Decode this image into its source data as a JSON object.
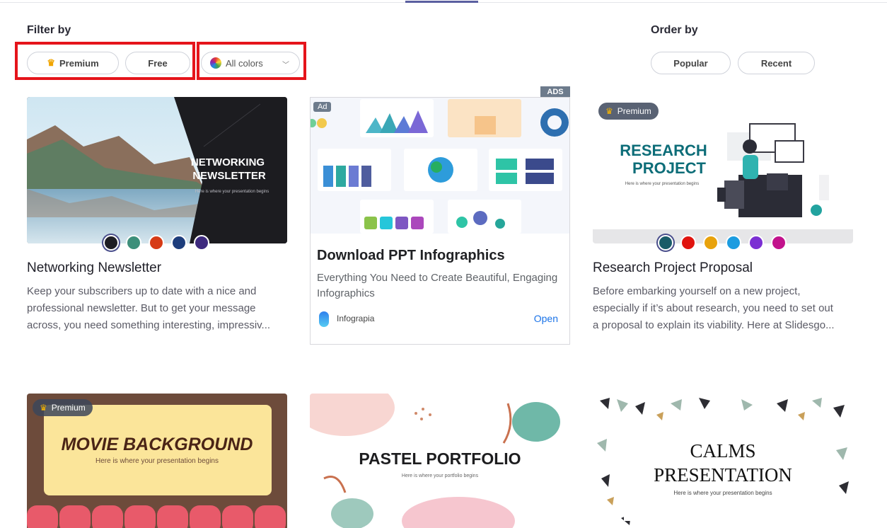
{
  "filter": {
    "label": "Filter by",
    "premium": "Premium",
    "free": "Free",
    "colors_placeholder": "All colors"
  },
  "order": {
    "label": "Order by",
    "popular": "Popular",
    "recent": "Recent"
  },
  "cards": [
    {
      "title": "Networking Newsletter",
      "image_title_line1": "NETWORKING",
      "image_title_line2": "NEWSLETTER",
      "image_subtitle": "Here is where your presentation begins",
      "desc_line1": "Keep your subscribers up to date with a nice and",
      "desc_line2": "professional newsletter. But to get your message",
      "desc_line3": "across, you need something interesting, impressiv...",
      "swatches": [
        "#1e1e24",
        "#3d8f7a",
        "#d63b16",
        "#1d3d7c",
        "#3e2a7e"
      ]
    },
    {
      "title": "Research Project Proposal",
      "badge": "Premium",
      "image_title_line1": "RESEARCH",
      "image_title_line2": "PROJECT",
      "image_subtitle": "Here is where your presentation begins",
      "desc_line1": "Before embarking yourself on a new project,",
      "desc_line2": "especially if it’s about research, you need to set out",
      "desc_line3": "a proposal to explain its viability. Here at Slidesgo...",
      "swatches": [
        "#1a5c68",
        "#e0140f",
        "#e8a20c",
        "#1c9ce0",
        "#7b2fd3",
        "#c2128c"
      ]
    },
    {
      "badge": "Premium",
      "image_title": "MOVIE BACKGROUND",
      "image_subtitle": "Here is where your presentation begins"
    },
    {
      "image_title": "PASTEL PORTFOLIO",
      "image_subtitle": "Here is where your portfolio begins"
    },
    {
      "image_title_line1": "CALMS",
      "image_title_line2": "PRESENTATION",
      "image_subtitle": "Here is where your presentation begins"
    }
  ],
  "ad": {
    "tag": "ADS",
    "chip": "Ad",
    "title": "Download PPT Infographics",
    "subtitle": "Everything You Need to Create Beautiful, Engaging Infographics",
    "brand": "Infograpia",
    "cta": "Open"
  }
}
